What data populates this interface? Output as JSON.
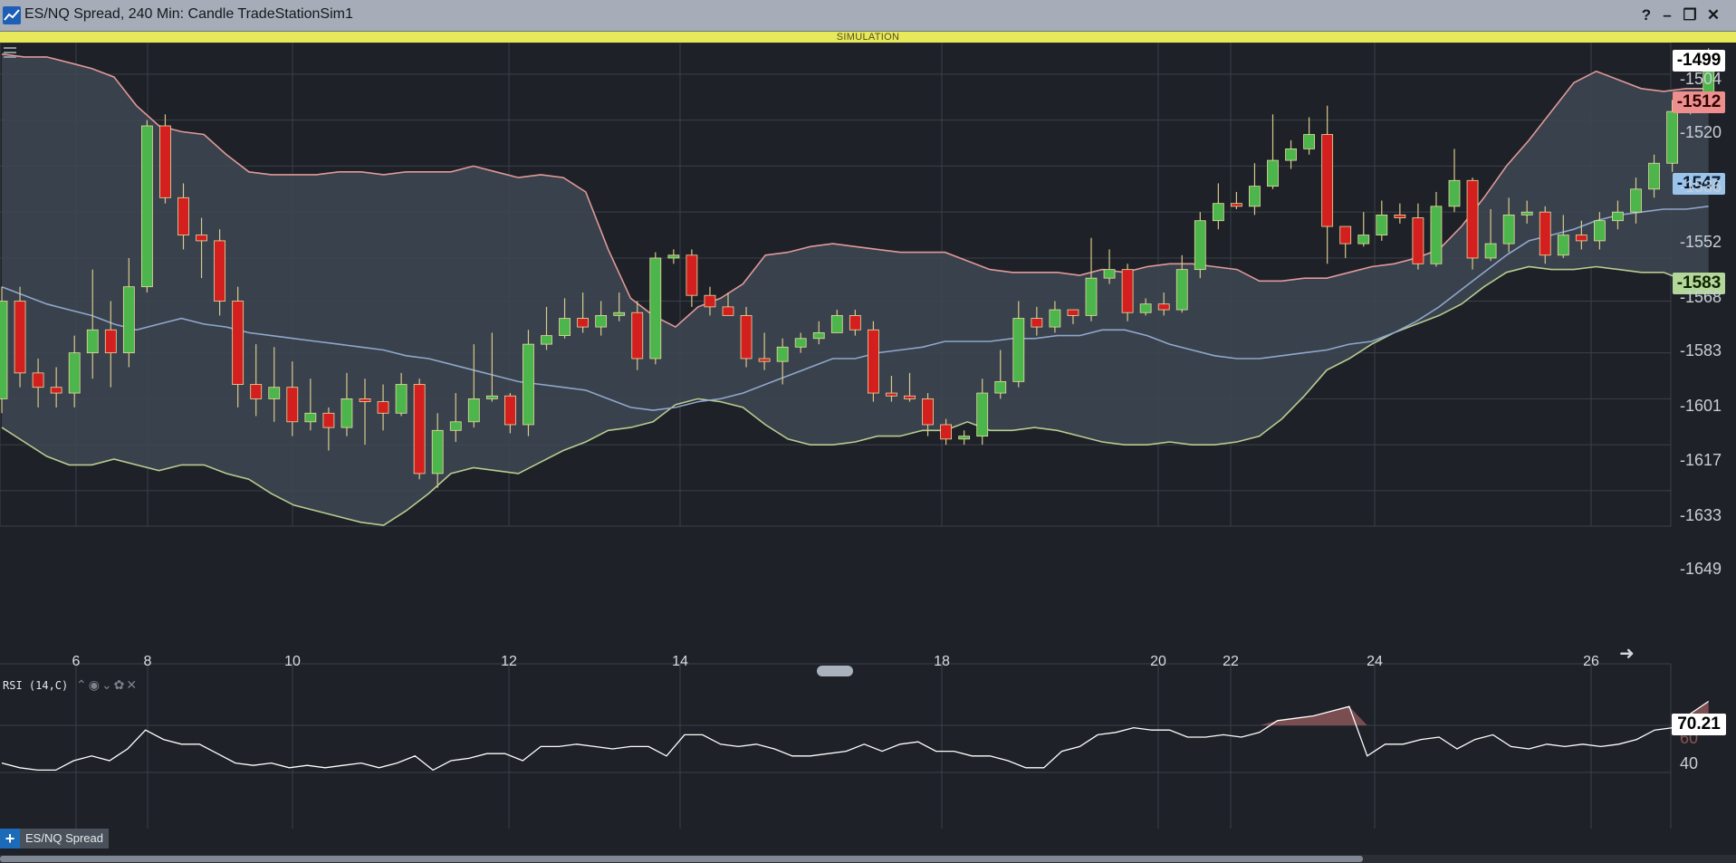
{
  "window": {
    "title": "ES/NQ Spread, 240 Min: Candle TradeStationSim1",
    "buttons": [
      "?",
      "–",
      "❐",
      "✕"
    ]
  },
  "sim_banner": "SIMULATION",
  "icons": {
    "app": "chart-line-icon",
    "menu": "hamburger-menu-icon",
    "scroll_right": "arrow-right-icon",
    "add": "plus-icon"
  },
  "colors": {
    "background": "#1e2127",
    "up_candle": "#4cb54c",
    "down_candle": "#d41f1f",
    "upper_band": "#e09a9a",
    "lower_band": "#b8cc90",
    "mid_band": "#8fa8cc",
    "band_fill": "#3e4653",
    "rsi_line": "#ffffff",
    "rsi_fill": "#7a4d50"
  },
  "price_axis": {
    "labels": [
      "-1504",
      "-1520",
      "-1536",
      "-1552",
      "-1568",
      "-1583",
      "-1601",
      "-1617",
      "-1633",
      "-1649"
    ]
  },
  "price_tags": [
    {
      "label": "-1499",
      "bg": "#ffffff",
      "fg": "#000000"
    },
    {
      "label": "-1512",
      "bg": "#ee8f8f",
      "fg": "#2a0000"
    },
    {
      "label": "-1547",
      "bg": "#9cc4ea",
      "fg": "#061a30"
    },
    {
      "label": "-1583",
      "bg": "#b3d79b",
      "fg": "#0c2200"
    }
  ],
  "date_axis": {
    "labels": [
      "6",
      "8",
      "10",
      "12",
      "14",
      "18",
      "20",
      "22",
      "24",
      "26"
    ]
  },
  "rsi": {
    "label": "RSI (14,C)",
    "tools": "⌃◉⌄✿✕",
    "axis_labels": [
      "60",
      "40"
    ],
    "value_tag": "70.21",
    "overbought": 60,
    "values": [
      44,
      42,
      41,
      41,
      45,
      47,
      45,
      50,
      58,
      54,
      52,
      52,
      48,
      44,
      43,
      44,
      42,
      43,
      42,
      43,
      44,
      42,
      44,
      47,
      41,
      45,
      46,
      48,
      48,
      45,
      51,
      51,
      52,
      51,
      50,
      51,
      51,
      47,
      56,
      56,
      52,
      51,
      52,
      50,
      47,
      47,
      48,
      49,
      52,
      49,
      52,
      53,
      49,
      49,
      47,
      47,
      45,
      42,
      42,
      49,
      51,
      56,
      57,
      59,
      58,
      58,
      55,
      55,
      56,
      55,
      57,
      62,
      63,
      64,
      66,
      68,
      47,
      52,
      52,
      54,
      55,
      50,
      54,
      56,
      51,
      50,
      52,
      51,
      52,
      51,
      52,
      54,
      58,
      59,
      65,
      70.21
    ]
  },
  "chart_data": {
    "type": "candlestick",
    "title": "ES/NQ Spread, 240 Min: Candle",
    "price_range": [
      -1661,
      -1493
    ],
    "candles": [
      [
        -1617,
        -1583,
        -1578,
        -1622
      ],
      [
        -1583,
        -1608,
        -1578,
        -1613
      ],
      [
        -1608,
        -1613,
        -1603,
        -1620
      ],
      [
        -1613,
        -1615,
        -1606,
        -1620
      ],
      [
        -1615,
        -1601,
        -1595,
        -1620
      ],
      [
        -1601,
        -1593,
        -1572,
        -1610
      ],
      [
        -1593,
        -1601,
        -1583,
        -1613
      ],
      [
        -1601,
        -1578,
        -1568,
        -1606
      ],
      [
        -1578,
        -1522,
        -1520,
        -1580
      ],
      [
        -1522,
        -1547,
        -1518,
        -1549
      ],
      [
        -1547,
        -1560,
        -1542,
        -1565
      ],
      [
        -1560,
        -1562,
        -1554,
        -1575
      ],
      [
        -1562,
        -1583,
        -1558,
        -1588
      ],
      [
        -1583,
        -1612,
        -1578,
        -1620
      ],
      [
        -1612,
        -1617,
        -1598,
        -1623
      ],
      [
        -1617,
        -1613,
        -1599,
        -1625
      ],
      [
        -1613,
        -1625,
        -1604,
        -1630
      ],
      [
        -1625,
        -1622,
        -1610,
        -1628
      ],
      [
        -1622,
        -1627,
        -1620,
        -1635
      ],
      [
        -1627,
        -1617,
        -1608,
        -1630
      ],
      [
        -1617,
        -1618,
        -1610,
        -1633
      ],
      [
        -1618,
        -1622,
        -1612,
        -1628
      ],
      [
        -1622,
        -1612,
        -1608,
        -1623
      ],
      [
        -1612,
        -1643,
        -1610,
        -1645
      ],
      [
        -1643,
        -1628,
        -1622,
        -1648
      ],
      [
        -1628,
        -1625,
        -1615,
        -1632
      ],
      [
        -1625,
        -1617,
        -1598,
        -1627
      ],
      [
        -1617,
        -1616,
        -1594,
        -1618
      ],
      [
        -1616,
        -1626,
        -1615,
        -1629
      ],
      [
        -1626,
        -1598,
        -1593,
        -1630
      ],
      [
        -1598,
        -1595,
        -1585,
        -1600
      ],
      [
        -1595,
        -1589,
        -1582,
        -1596
      ],
      [
        -1589,
        -1592,
        -1580,
        -1594
      ],
      [
        -1592,
        -1588,
        -1583,
        -1595
      ],
      [
        -1588,
        -1587,
        -1580,
        -1590
      ],
      [
        -1587,
        -1603,
        -1583,
        -1607
      ],
      [
        -1603,
        -1568,
        -1566,
        -1605
      ],
      [
        -1568,
        -1567,
        -1565,
        -1570
      ],
      [
        -1567,
        -1581,
        -1565,
        -1585
      ],
      [
        -1581,
        -1585,
        -1578,
        -1588
      ],
      [
        -1585,
        -1588,
        -1580,
        -1588
      ],
      [
        -1588,
        -1603,
        -1585,
        -1606
      ],
      [
        -1603,
        -1604,
        -1594,
        -1607
      ],
      [
        -1604,
        -1599,
        -1596,
        -1612
      ],
      [
        -1599,
        -1596,
        -1594,
        -1601
      ],
      [
        -1596,
        -1594,
        -1590,
        -1598
      ],
      [
        -1594,
        -1588,
        -1586,
        -1594
      ],
      [
        -1588,
        -1593,
        -1586,
        -1595
      ],
      [
        -1593,
        -1615,
        -1590,
        -1618
      ],
      [
        -1615,
        -1616,
        -1609,
        -1618
      ],
      [
        -1616,
        -1617,
        -1608,
        -1618
      ],
      [
        -1617,
        -1626,
        -1615,
        -1630
      ],
      [
        -1626,
        -1631,
        -1624,
        -1633
      ],
      [
        -1631,
        -1630,
        -1628,
        -1633
      ],
      [
        -1630,
        -1615,
        -1610,
        -1633
      ],
      [
        -1615,
        -1611,
        -1600,
        -1617
      ],
      [
        -1611,
        -1589,
        -1583,
        -1613
      ],
      [
        -1589,
        -1592,
        -1585,
        -1595
      ],
      [
        -1592,
        -1586,
        -1583,
        -1594
      ],
      [
        -1586,
        -1588,
        -1586,
        -1591
      ],
      [
        -1588,
        -1575,
        -1561,
        -1590
      ],
      [
        -1575,
        -1572,
        -1565,
        -1577
      ],
      [
        -1572,
        -1587,
        -1570,
        -1590
      ],
      [
        -1587,
        -1584,
        -1582,
        -1588
      ],
      [
        -1584,
        -1586,
        -1580,
        -1588
      ],
      [
        -1586,
        -1572,
        -1567,
        -1587
      ],
      [
        -1572,
        -1555,
        -1552,
        -1575
      ],
      [
        -1555,
        -1549,
        -1542,
        -1558
      ],
      [
        -1549,
        -1550,
        -1545,
        -1551
      ],
      [
        -1550,
        -1543,
        -1535,
        -1553
      ],
      [
        -1543,
        -1534,
        -1518,
        -1544
      ],
      [
        -1534,
        -1530,
        -1527,
        -1537
      ],
      [
        -1530,
        -1525,
        -1519,
        -1532
      ],
      [
        -1525,
        -1557,
        -1515,
        -1570
      ],
      [
        -1557,
        -1563,
        -1557,
        -1568
      ],
      [
        -1563,
        -1560,
        -1552,
        -1564
      ],
      [
        -1560,
        -1553,
        -1548,
        -1562
      ],
      [
        -1553,
        -1554,
        -1549,
        -1556
      ],
      [
        -1554,
        -1570,
        -1549,
        -1572
      ],
      [
        -1570,
        -1550,
        -1545,
        -1571
      ],
      [
        -1550,
        -1541,
        -1530,
        -1552
      ],
      [
        -1541,
        -1568,
        -1540,
        -1572
      ],
      [
        -1568,
        -1563,
        -1551,
        -1569
      ],
      [
        -1563,
        -1553,
        -1547,
        -1566
      ],
      [
        -1553,
        -1552,
        -1548,
        -1556
      ],
      [
        -1552,
        -1567,
        -1550,
        -1570
      ],
      [
        -1567,
        -1560,
        -1553,
        -1568
      ],
      [
        -1560,
        -1562,
        -1555,
        -1565
      ],
      [
        -1562,
        -1555,
        -1552,
        -1565
      ],
      [
        -1555,
        -1552,
        -1548,
        -1558
      ],
      [
        -1552,
        -1544,
        -1540,
        -1556
      ],
      [
        -1544,
        -1535,
        -1532,
        -1547
      ],
      [
        -1535,
        -1517,
        -1513,
        -1538
      ],
      [
        -1517,
        -1513,
        -1511,
        -1518
      ],
      [
        -1513,
        -1497,
        -1495,
        -1514
      ]
    ],
    "bollinger_upper": [
      -1497,
      -1498,
      -1498,
      -1500,
      -1502,
      -1505,
      -1515,
      -1522,
      -1524,
      -1525,
      -1532,
      -1538,
      -1539,
      -1539,
      -1539,
      -1538,
      -1538,
      -1539,
      -1538,
      -1538,
      -1538,
      -1536,
      -1538,
      -1540,
      -1539,
      -1540,
      -1545,
      -1565,
      -1582,
      -1588,
      -1592,
      -1585,
      -1582,
      -1577,
      -1567,
      -1566,
      -1564,
      -1563,
      -1564,
      -1565,
      -1566,
      -1566,
      -1566,
      -1569,
      -1572,
      -1573,
      -1573,
      -1573,
      -1574,
      -1572,
      -1573,
      -1571,
      -1570,
      -1570,
      -1571,
      -1572,
      -1576,
      -1576,
      -1575,
      -1575,
      -1573,
      -1571,
      -1570,
      -1568,
      -1565,
      -1557,
      -1547,
      -1536,
      -1527,
      -1517,
      -1507,
      -1503,
      -1506,
      -1509,
      -1510,
      -1509,
      -1509,
      -1508,
      -1508,
      -1507,
      -1505,
      -1506,
      -1507,
      -1510,
      -1511,
      -1510,
      -1512,
      -1512,
      -1512,
      -1513,
      -1513,
      -1513,
      -1512,
      -1507,
      -1500
    ],
    "bollinger_mid": [
      -1578,
      -1581,
      -1584,
      -1586,
      -1588,
      -1591,
      -1593,
      -1591,
      -1589,
      -1591,
      -1592,
      -1594,
      -1595,
      -1596,
      -1597,
      -1598,
      -1599,
      -1600,
      -1602,
      -1603,
      -1605,
      -1607,
      -1609,
      -1611,
      -1612,
      -1613,
      -1614,
      -1617,
      -1620,
      -1621,
      -1620,
      -1618,
      -1617,
      -1615,
      -1612,
      -1609,
      -1606,
      -1603,
      -1603,
      -1601,
      -1600,
      -1599,
      -1597,
      -1597,
      -1597,
      -1596,
      -1596,
      -1595,
      -1595,
      -1593,
      -1593,
      -1595,
      -1598,
      -1600,
      -1602,
      -1603,
      -1603,
      -1602,
      -1601,
      -1600,
      -1598,
      -1597,
      -1594,
      -1590,
      -1585,
      -1579,
      -1573,
      -1567,
      -1562,
      -1560,
      -1558,
      -1555,
      -1553,
      -1552,
      -1551,
      -1551,
      -1550,
      -1549,
      -1549,
      -1549,
      -1548,
      -1550,
      -1550,
      -1551,
      -1552,
      -1551,
      -1551,
      -1549,
      -1547,
      -1543
    ],
    "bollinger_lower": [
      -1627,
      -1632,
      -1637,
      -1640,
      -1640,
      -1638,
      -1640,
      -1642,
      -1640,
      -1640,
      -1643,
      -1645,
      -1650,
      -1654,
      -1656,
      -1658,
      -1660,
      -1661,
      -1656,
      -1650,
      -1643,
      -1641,
      -1642,
      -1643,
      -1639,
      -1635,
      -1632,
      -1628,
      -1627,
      -1625,
      -1619,
      -1617,
      -1618,
      -1620,
      -1626,
      -1631,
      -1633,
      -1633,
      -1632,
      -1630,
      -1630,
      -1628,
      -1628,
      -1625,
      -1628,
      -1628,
      -1627,
      -1628,
      -1630,
      -1632,
      -1633,
      -1633,
      -1632,
      -1633,
      -1633,
      -1632,
      -1630,
      -1624,
      -1616,
      -1607,
      -1603,
      -1598,
      -1594,
      -1591,
      -1588,
      -1584,
      -1578,
      -1573,
      -1571,
      -1572,
      -1572,
      -1571,
      -1572,
      -1573,
      -1573,
      -1576,
      -1578
    ]
  }
}
